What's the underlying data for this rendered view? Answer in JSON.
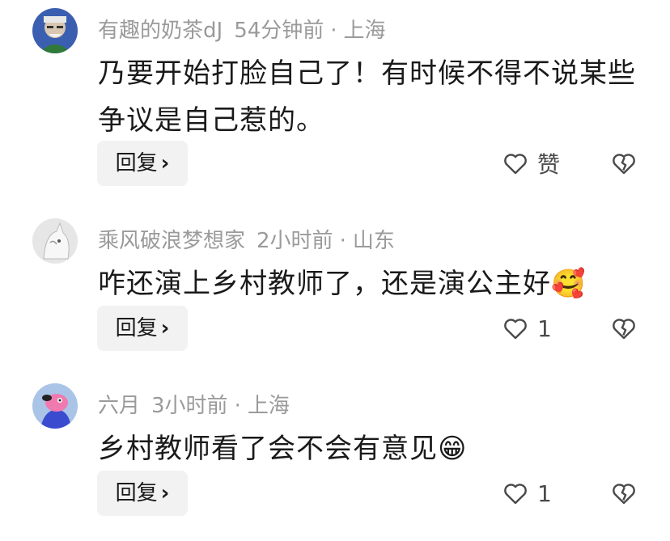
{
  "comments": [
    {
      "user": "有趣的奶茶dJ",
      "time": "54分钟前",
      "location": "上海",
      "text": "乃要开始打脸自己了！有时候不得不说某些争议是自己惹的。",
      "emoji": "",
      "reply_label": "回复",
      "like_label": "赞",
      "avatar": "old-man-avatar"
    },
    {
      "user": "乘风破浪梦想家",
      "time": "2小时前",
      "location": "山东",
      "text": "咋还演上乡村教师了，还是演公主好",
      "emoji": "🥰",
      "reply_label": "回复",
      "like_label": "1",
      "avatar": "cat-avatar"
    },
    {
      "user": "六月",
      "time": "3小时前",
      "location": "上海",
      "text": "乡村教师看了会不会有意见",
      "emoji": "😁",
      "reply_label": "回复",
      "like_label": "1",
      "avatar": "cartoon-dog-avatar"
    }
  ],
  "separator": "·",
  "colors": {
    "meta": "#9a9a9a",
    "text": "#1a1a1a",
    "reply_bg": "#f2f2f2"
  }
}
